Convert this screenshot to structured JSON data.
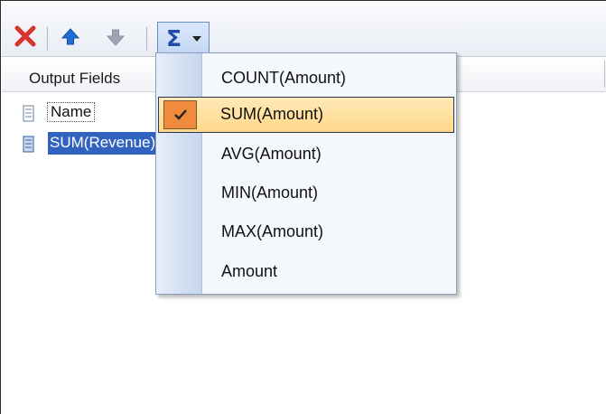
{
  "toolbar": {
    "icons": [
      "delete-icon",
      "move-up-icon",
      "move-down-icon",
      "sigma-icon",
      "chevron-down-icon"
    ],
    "aggregate_symbol": "Σ"
  },
  "grid": {
    "header": "Output Fields",
    "rows": [
      {
        "label": "Name",
        "icon": "field-icon",
        "selected": false
      },
      {
        "label": "SUM(Revenue)",
        "icon": "field-icon",
        "selected": true
      }
    ]
  },
  "menu": {
    "items": [
      {
        "label": "COUNT(Amount)",
        "checked": false
      },
      {
        "label": "SUM(Amount)",
        "checked": true
      },
      {
        "label": "AVG(Amount)",
        "checked": false
      },
      {
        "label": "MIN(Amount)",
        "checked": false
      },
      {
        "label": "MAX(Amount)",
        "checked": false
      },
      {
        "label": "Amount",
        "checked": false
      }
    ]
  },
  "colors": {
    "accent": "#3162c0",
    "delete": "#d9342b",
    "check_highlight": "#ffd889",
    "check_mark_bg": "#f08a3c"
  }
}
